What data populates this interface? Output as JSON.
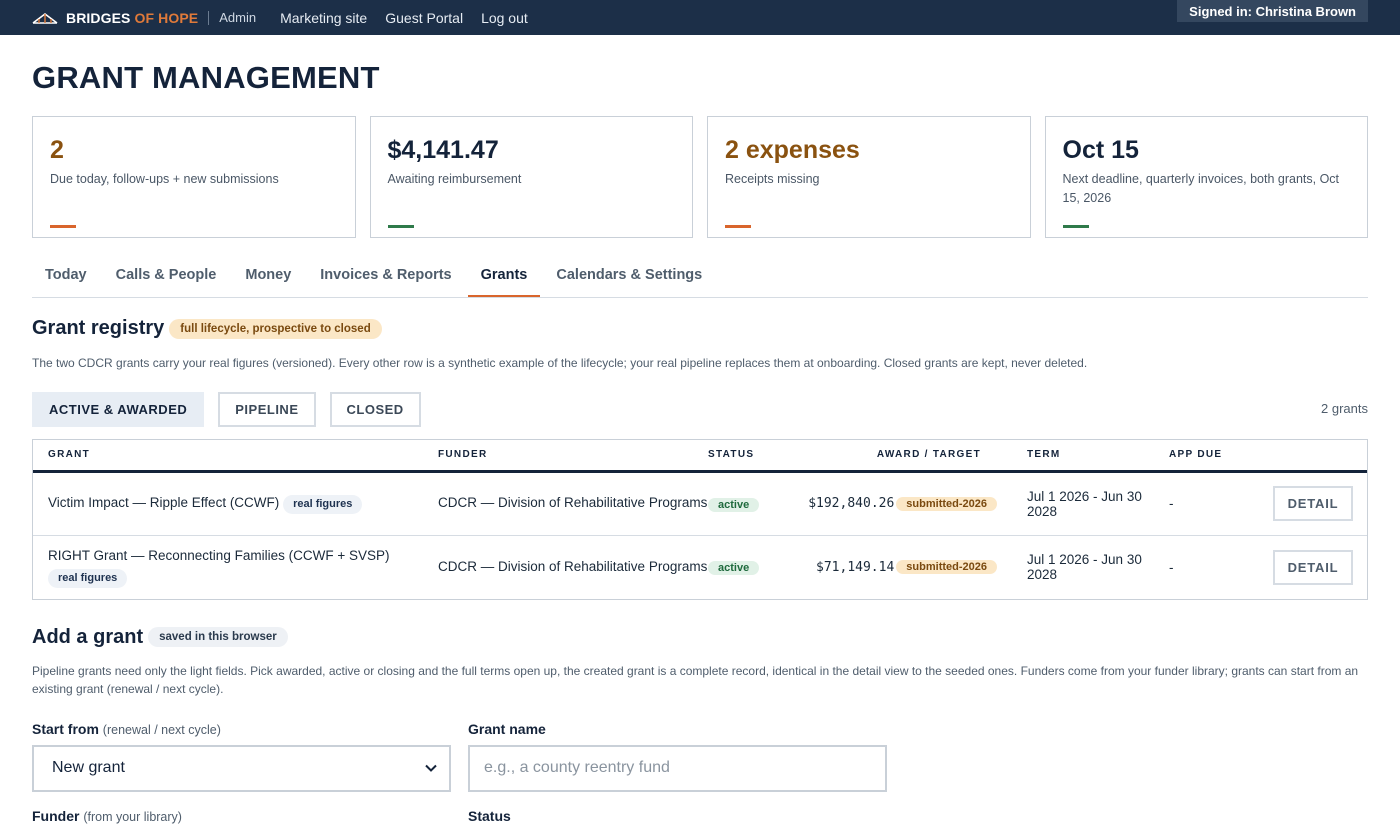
{
  "topbar": {
    "brand_main": "BRIDGES",
    "brand_accent": "OF HOPE",
    "admin": "Admin",
    "links": [
      "Marketing site",
      "Guest Portal",
      "Log out"
    ],
    "signed_in": "Signed in: Christina Brown"
  },
  "page_title": "GRANT MANAGEMENT",
  "cards": [
    {
      "value": "2",
      "desc": "Due today, follow-ups + new submissions",
      "value_color": "#8a5210",
      "bar_color": "#d9652c"
    },
    {
      "value": "$4,141.47",
      "desc": "Awaiting reimbursement",
      "value_color": "#14233a",
      "bar_color": "#2f7a4a"
    },
    {
      "value": "2 expenses",
      "desc": "Receipts missing",
      "value_color": "#8a5210",
      "bar_color": "#d9652c"
    },
    {
      "value": "Oct 15",
      "desc": "Next deadline, quarterly invoices, both grants, Oct 15, 2026",
      "value_color": "#14233a",
      "bar_color": "#2f7a4a"
    }
  ],
  "tabs": [
    "Today",
    "Calls & People",
    "Money",
    "Invoices & Reports",
    "Grants",
    "Calendars & Settings"
  ],
  "active_tab": "Grants",
  "registry": {
    "title": "Grant registry",
    "badge": "full lifecycle, prospective to closed",
    "description": "The two CDCR grants carry your real figures (versioned). Every other row is a synthetic example of the lifecycle; your real pipeline replaces them at onboarding. Closed grants are kept, never deleted.",
    "filters": [
      "ACTIVE & AWARDED",
      "PIPELINE",
      "CLOSED"
    ],
    "active_filter": "ACTIVE & AWARDED",
    "count": "2 grants"
  },
  "table": {
    "headers": {
      "grant": "GRANT",
      "funder": "FUNDER",
      "status": "STATUS",
      "award": "AWARD / TARGET",
      "term": "TERM",
      "due": "APP DUE"
    },
    "rows": [
      {
        "name": "Victim Impact — Ripple Effect (CCWF)",
        "tag": "real figures",
        "funder": "CDCR — Division of Rehabilitative Programs",
        "status": "active",
        "award": "$192,840.26",
        "award_tag": "submitted-2026",
        "term": "Jul 1 2026 - Jun 30 2028",
        "due": "-",
        "action": "DETAIL"
      },
      {
        "name": "RIGHT Grant — Reconnecting Families (CCWF + SVSP)",
        "tag": "real figures",
        "funder": "CDCR — Division of Rehabilitative Programs",
        "status": "active",
        "award": "$71,149.14",
        "award_tag": "submitted-2026",
        "term": "Jul 1 2026 - Jun 30 2028",
        "due": "-",
        "action": "DETAIL"
      }
    ]
  },
  "add_grant": {
    "title": "Add a grant",
    "badge": "saved in this browser",
    "description": "Pipeline grants need only the light fields. Pick awarded, active or closing and the full terms open up, the created grant is a complete record, identical in the detail view to the seeded ones. Funders come from your funder library; grants can start from an existing grant (renewal / next cycle).",
    "start_from_label": "Start from",
    "start_from_hint": "(renewal / next cycle)",
    "start_from_value": "New grant",
    "grant_name_label": "Grant name",
    "grant_name_placeholder": "e.g., a county reentry fund",
    "funder_label": "Funder",
    "funder_hint": "(from your library)",
    "status_label": "Status"
  }
}
